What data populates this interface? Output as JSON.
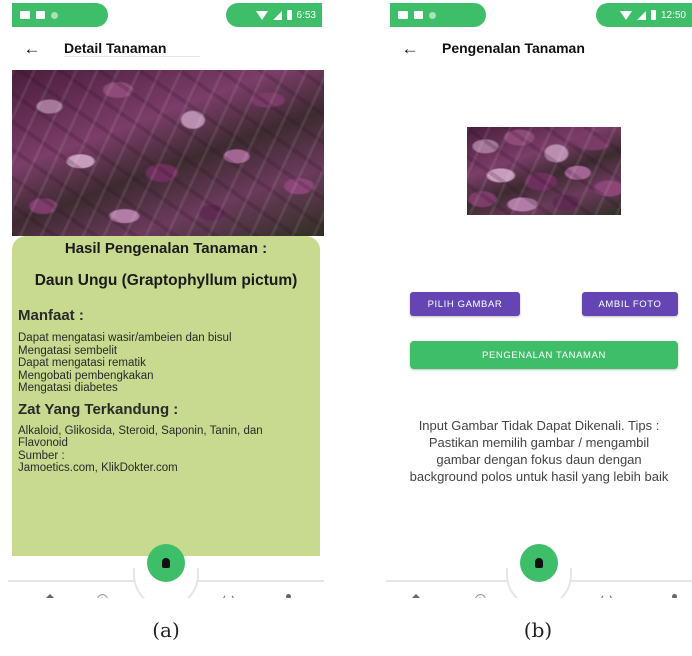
{
  "screen_a": {
    "status_time": "6:53",
    "title": "Detail Tanaman",
    "result_heading": "Hasil Pengenalan Tanaman :",
    "result_name": "Daun Ungu (Graptophyllum pictum)",
    "benefits_title": "Manfaat :",
    "benefits": [
      "Dapat mengatasi wasir/ambeien dan bisul",
      "Mengatasi sembelit",
      "Dapat mengatasi rematik",
      "Mengobati pembengkakan",
      "Mengatasi diabetes"
    ],
    "ingredients_title": "Zat Yang Terkandung :",
    "ingredients_lines": [
      "Alkaloid, Glikosida, Steroid, Saponin, Tanin, dan",
      "Flavonoid",
      "Sumber :",
      "Jamoetics.com, KlikDokter.com"
    ]
  },
  "screen_b": {
    "status_time": "12:50",
    "title": "Pengenalan Tanaman",
    "pick_image_label": "PILIH GAMBAR",
    "take_photo_label": "AMBIL FOTO",
    "recognize_label": "PENGENALAN TANAMAN",
    "message_lines": [
      "Input Gambar Tidak Dapat Dikenali. Tips :",
      "Pastikan memilih gambar / mengambil",
      "gambar dengan fokus daun dengan",
      "background polos untuk hasil yang lebih baik"
    ]
  },
  "captions": {
    "a": "(a)",
    "b": "(b)"
  },
  "icons": {
    "back": "arrow-left-icon",
    "home": "home-icon",
    "info": "info-icon",
    "recognize": "lightbulb-icon",
    "history": "history-icon",
    "profile": "person-icon"
  },
  "colors": {
    "status_green": "#3fbe6a",
    "result_panel": "#c7da8f",
    "button_purple": "#6545b4",
    "button_green": "#3fbe6a"
  }
}
